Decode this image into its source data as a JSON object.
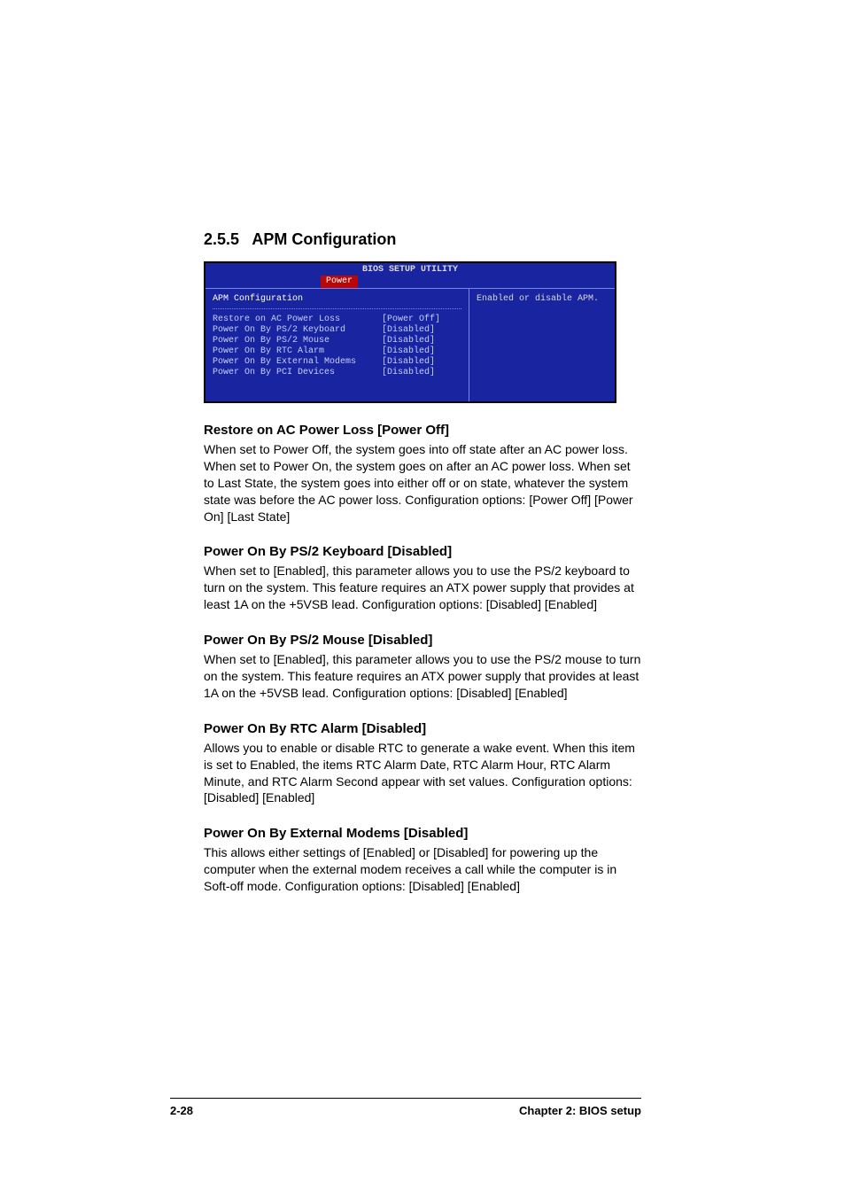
{
  "section_number": "2.5.5",
  "section_title": "APM Configuration",
  "bios": {
    "title": "BIOS SETUP UTILITY",
    "active_tab": "Power",
    "panel_heading": "APM Configuration",
    "help_text": "Enabled or disable APM.",
    "rows": [
      {
        "label": "Restore on AC Power Loss",
        "value": "[Power Off]"
      },
      {
        "label": "Power On By PS/2 Keyboard",
        "value": "[Disabled]"
      },
      {
        "label": "Power On By PS/2 Mouse",
        "value": "[Disabled]"
      },
      {
        "label": "Power On By RTC Alarm",
        "value": "[Disabled]"
      },
      {
        "label": "Power On By External Modems",
        "value": "[Disabled]"
      },
      {
        "label": "Power On By PCI Devices",
        "value": "[Disabled]"
      }
    ]
  },
  "options": [
    {
      "title": "Restore on AC Power Loss [Power Off]",
      "body": "When set to Power Off, the system goes into off state after an AC power loss. When set to Power On, the system goes on after an AC power loss. When set to Last State, the system goes into either off or on state, whatever the system state was before the AC power loss. Configuration options: [Power Off] [Power On] [Last State]"
    },
    {
      "title": "Power On By PS/2 Keyboard [Disabled]",
      "body": "When set to [Enabled], this parameter allows you to use the PS/2 keyboard to turn on the system. This feature requires an ATX power supply that provides at least 1A on the +5VSB lead. Configuration options: [Disabled] [Enabled]"
    },
    {
      "title": "Power On By PS/2 Mouse [Disabled]",
      "body": "When set to [Enabled], this parameter allows you to use the PS/2 mouse to turn on the system. This feature requires an ATX power supply that provides at least 1A on the +5VSB lead. Configuration options: [Disabled] [Enabled]"
    },
    {
      "title": "Power On By RTC Alarm [Disabled]",
      "body": "Allows you to enable or disable RTC to generate a wake event. When this item is set to Enabled, the items RTC Alarm Date, RTC Alarm Hour, RTC Alarm Minute, and RTC Alarm Second appear with set values. Configuration options: [Disabled] [Enabled]"
    },
    {
      "title": "Power On By External Modems [Disabled]",
      "body": "This allows either settings of [Enabled] or [Disabled] for powering up the computer when the external modem receives a call while the computer is in Soft-off mode. Configuration options: [Disabled] [Enabled]"
    }
  ],
  "footer": {
    "page": "2-28",
    "chapter": "Chapter 2: BIOS setup"
  }
}
